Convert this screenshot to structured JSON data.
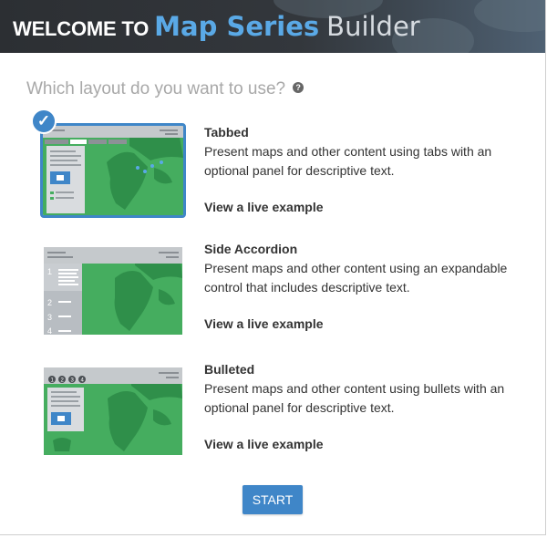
{
  "header": {
    "welcome": "WELCOME TO",
    "brand": "Map Series",
    "builder": "Builder"
  },
  "question": {
    "text": "Which layout do you want to use?",
    "help_icon_glyph": "?"
  },
  "colors": {
    "accent": "#3f86c8",
    "map_green": "#45ad5f",
    "land_green": "#2f8f4a",
    "panel_gray": "#c5c9cc"
  },
  "layouts": [
    {
      "title": "Tabbed",
      "description": "Present maps and other content using tabs with an optional panel for descriptive text.",
      "link": "View a live example",
      "selected": true,
      "icon": "tabbed-layout-thumbnail"
    },
    {
      "title": "Side Accordion",
      "description": "Present maps and other content using an expandable control that includes descriptive text.",
      "link": "View a live example",
      "selected": false,
      "icon": "accordion-layout-thumbnail",
      "numbers": [
        "1",
        "2",
        "3",
        "4"
      ]
    },
    {
      "title": "Bulleted",
      "description": "Present maps and other content using bullets with an optional panel for descriptive text.",
      "link": "View a live example",
      "selected": false,
      "icon": "bulleted-layout-thumbnail",
      "bullets": [
        "1",
        "2",
        "3",
        "4"
      ]
    }
  ],
  "start_button": {
    "label": "START"
  }
}
